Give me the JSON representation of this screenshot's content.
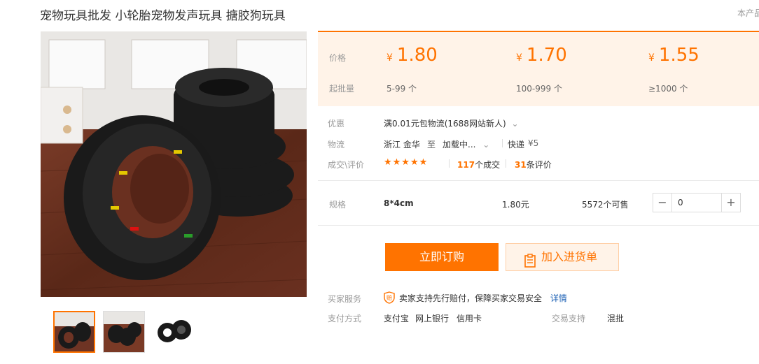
{
  "title": "宠物玩具批发 小轮胎宠物发声玩具 搪胶狗玩具",
  "side_note": "本产品",
  "price_block": {
    "price_label": "价格",
    "moq_label": "起批量",
    "currency": "¥",
    "tiers": [
      {
        "price": "1.80",
        "range": "5-99 个"
      },
      {
        "price": "1.70",
        "range": "100-999 个"
      },
      {
        "price": "1.55",
        "range": "≥1000 个"
      }
    ]
  },
  "info": {
    "promo_label": "优惠",
    "promo_value": "满0.01元包物流(1688网站新人)",
    "logistics_label": "物流",
    "origin": "浙江 金华",
    "to": "至",
    "destination": "加载中...",
    "shipping": "快递",
    "shipping_price": "¥5",
    "deals_label": "成交\\评价",
    "stars": "★★★★★",
    "deals_count": "117",
    "deals_text": "个成交",
    "reviews_count": "31",
    "reviews_text": "条评价"
  },
  "spec": {
    "label": "规格",
    "name": "8*4cm",
    "price": "1.80元",
    "stock": "5572个可售",
    "quantity": "0",
    "minus": "−",
    "plus": "+"
  },
  "actions": {
    "buy_label": "立即订购",
    "cart_label": "加入进货单"
  },
  "service": {
    "buyer_service_label": "买家服务",
    "buyer_service_text": "卖家支持先行赔付，保障买家交易安全",
    "details_link": "详情",
    "payment_label": "支付方式",
    "payment_methods": [
      "支付宝",
      "网上银行",
      "信用卡"
    ],
    "trade_support_label": "交易支持",
    "trade_support_value": "混批"
  },
  "colors": {
    "accent": "#ff7300",
    "price_bg": "#fff3e8"
  }
}
